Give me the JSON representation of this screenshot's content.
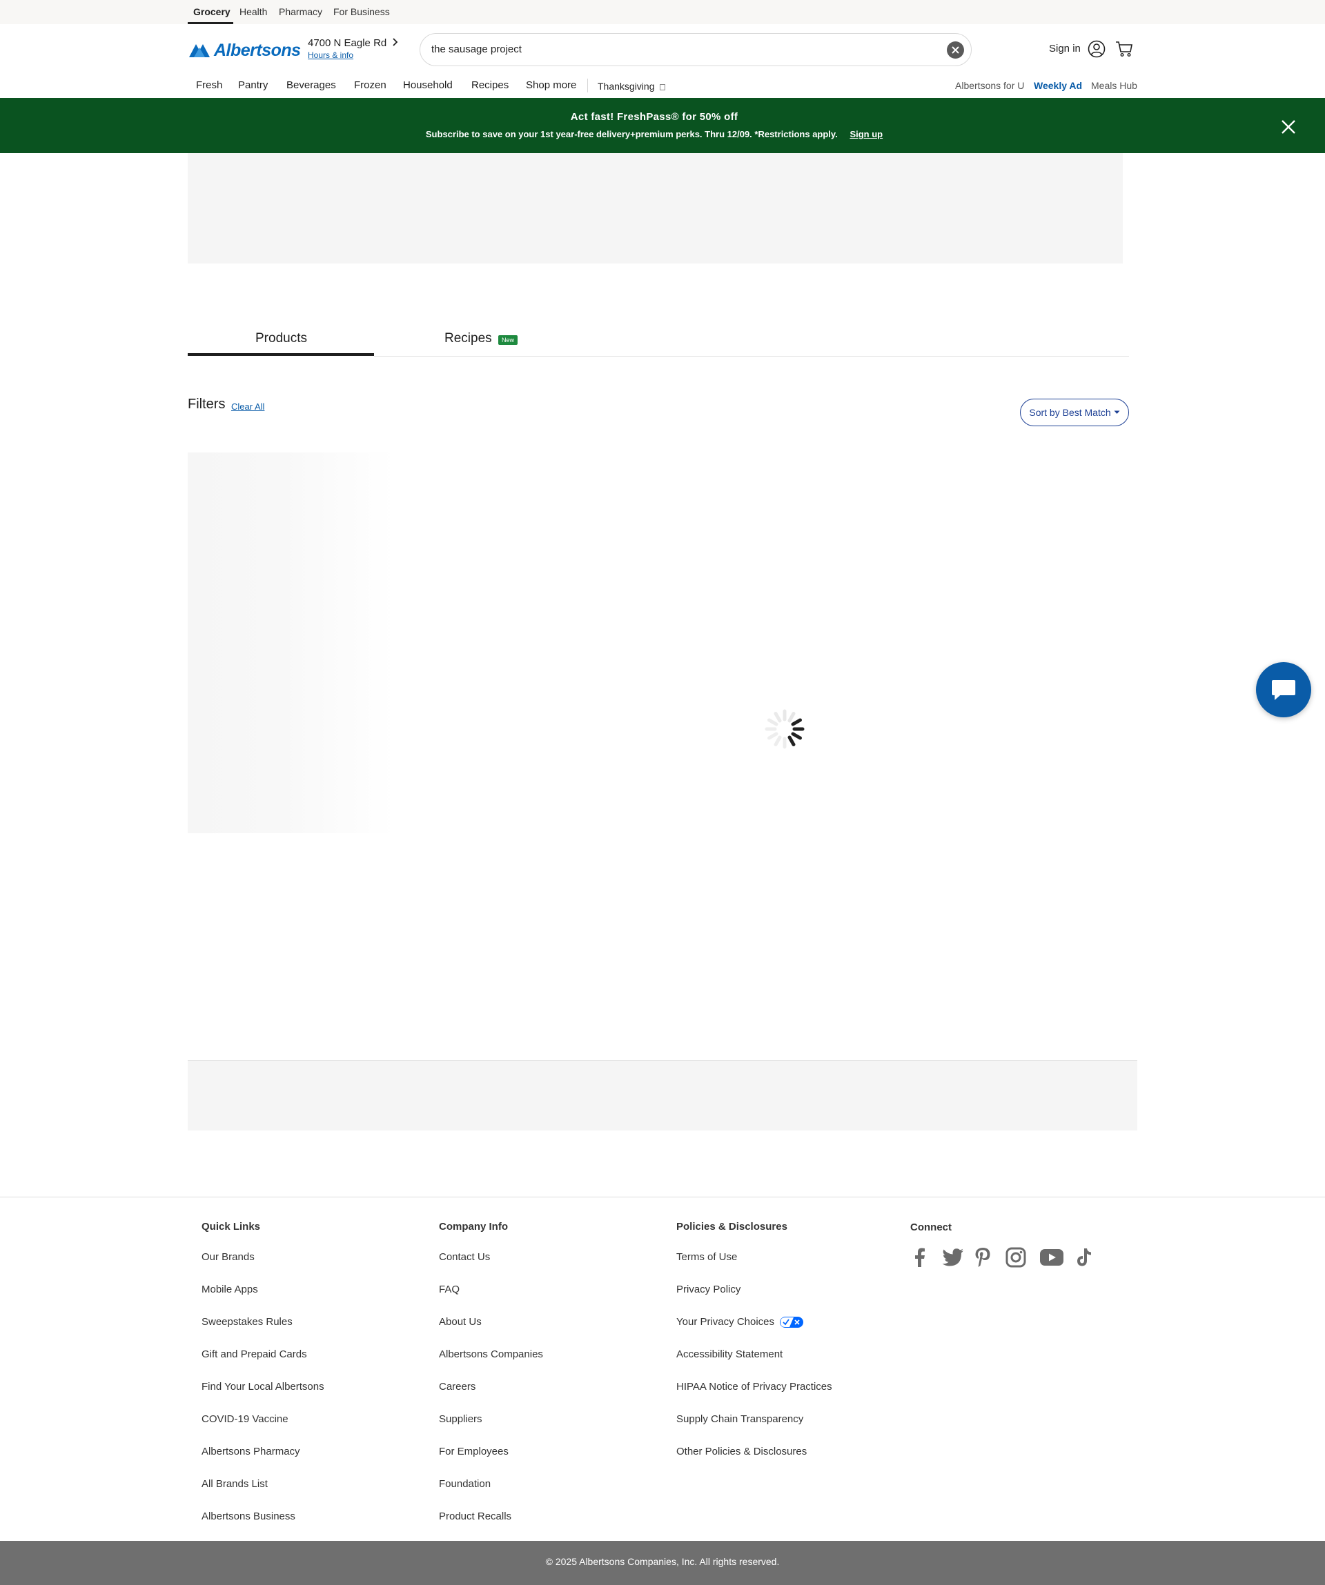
{
  "utility_nav": {
    "items": [
      "Grocery",
      "Health",
      "Pharmacy",
      "For Business"
    ]
  },
  "header": {
    "brand": "Albertsons",
    "store_address": "4700 N Eagle Rd",
    "store_hours_link": "Hours & info",
    "search_value": "the sausage project",
    "sign_in_label": "Sign in"
  },
  "category_nav": {
    "items": [
      "Fresh",
      "Pantry",
      "Beverages",
      "Frozen",
      "Household",
      "Recipes",
      "Shop more"
    ],
    "seasonal": "Thanksgiving",
    "right_links": [
      "Albertsons for U",
      "Weekly Ad",
      "Meals Hub"
    ]
  },
  "promo": {
    "title": "Act fast! FreshPass® for 50% off",
    "subtitle": "Subscribe to save on your 1st year-free delivery+premium perks. Thru 12/09. *Restrictions apply.",
    "cta": "Sign up"
  },
  "tabs": {
    "items": [
      "Products",
      "Recipes"
    ],
    "new_badge": "New",
    "active": "Products"
  },
  "filters": {
    "title": "Filters",
    "clear_all": "Clear All",
    "sort_label": "Sort by Best Match"
  },
  "footer": {
    "columns": [
      {
        "heading": "Quick Links",
        "links": [
          "Our Brands",
          "Mobile Apps",
          "Sweepstakes Rules",
          "Gift and Prepaid Cards",
          "Find Your Local Albertsons",
          "COVID-19 Vaccine",
          "Albertsons Pharmacy",
          "All Brands List",
          "Albertsons Business"
        ]
      },
      {
        "heading": "Company Info",
        "links": [
          "Contact Us",
          "FAQ",
          "About Us",
          "Albertsons Companies",
          "Careers",
          "Suppliers",
          "For Employees",
          "Foundation",
          "Product Recalls"
        ]
      },
      {
        "heading": "Policies & Disclosures",
        "links": [
          "Terms of Use",
          "Privacy Policy",
          "Your Privacy Choices",
          "Accessibility Statement",
          "HIPAA Notice of Privacy Practices",
          "Supply Chain Transparency",
          "Other Policies & Disclosures"
        ]
      }
    ],
    "connect_heading": "Connect",
    "social_icons": [
      "facebook-icon",
      "twitter-icon",
      "pinterest-icon",
      "instagram-icon",
      "youtube-icon",
      "tiktok-icon"
    ],
    "copyright": "© 2025 Albertsons Companies, Inc.  All rights reserved."
  },
  "colors": {
    "brand_blue": "#0a6bbd",
    "promo_green": "#0a5320",
    "sort_border": "#1c3f94",
    "chat_button": "#0a5ca8",
    "copyright_bar": "#6f6f6f"
  }
}
